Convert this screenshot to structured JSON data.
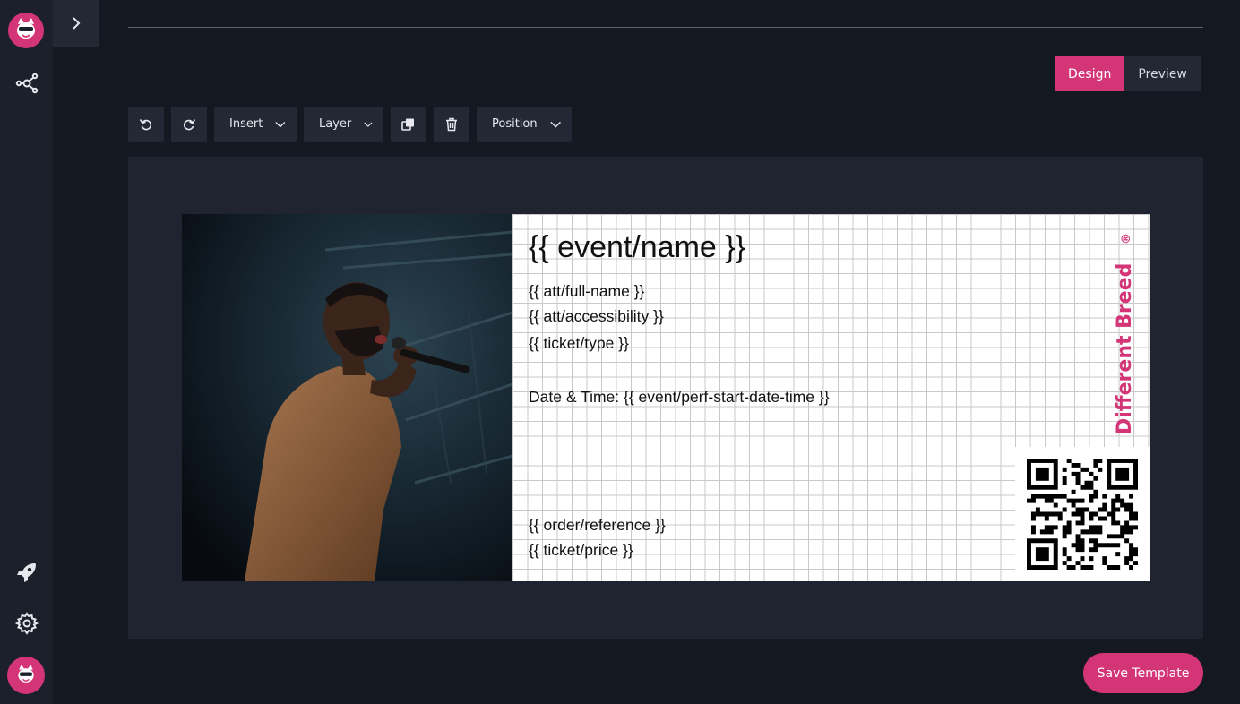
{
  "sidebar": {
    "icons": [
      "cat-logo-icon",
      "network-nodes-icon",
      "rocket-icon",
      "gear-icon",
      "user-avatar"
    ],
    "brand_color": "#d33577"
  },
  "mode": {
    "design_label": "Design",
    "preview_label": "Preview",
    "active": "Design"
  },
  "toolbar": {
    "insert_label": "Insert",
    "layer_label": "Layer",
    "position_label": "Position"
  },
  "ticket": {
    "title": "{{ event/name }}",
    "full_name": "{{ att/full-name }}",
    "accessibility": "{{ att/accessibility }}",
    "ticket_type": "{{ ticket/type }}",
    "date_time": "Date & Time: {{ event/perf-start-date-time }}",
    "order_ref": "{{ order/reference }}",
    "price": "{{ ticket/price }}",
    "brand_text": "Different Breed",
    "brand_mark": "®",
    "brand_color": "#d33577"
  },
  "actions": {
    "save_label": "Save Template"
  }
}
